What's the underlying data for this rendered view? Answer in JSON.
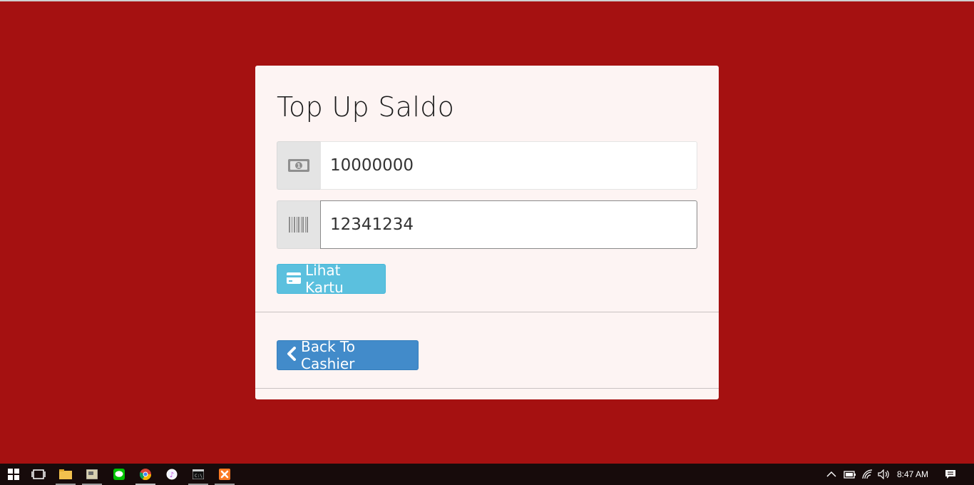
{
  "card": {
    "title": "Top Up Saldo",
    "amount_field": {
      "value": "10000000",
      "icon": "money-bill-icon"
    },
    "card_field": {
      "value": "12341234",
      "icon": "barcode-icon"
    },
    "view_card_button": {
      "label": "Lihat Kartu",
      "icon": "credit-card-icon"
    },
    "back_button": {
      "label": "Back To Cashier",
      "icon": "chevron-left-icon"
    }
  },
  "taskbar": {
    "clock": "8:47 AM",
    "apps": [
      "start",
      "task-view",
      "file-explorer",
      "app",
      "line",
      "chrome",
      "itunes",
      "cmd",
      "xampp"
    ]
  },
  "colors": {
    "page_bg": "#a51111",
    "card_bg": "#fdf4f3",
    "info": "#5bc0de",
    "primary": "#428bca"
  }
}
